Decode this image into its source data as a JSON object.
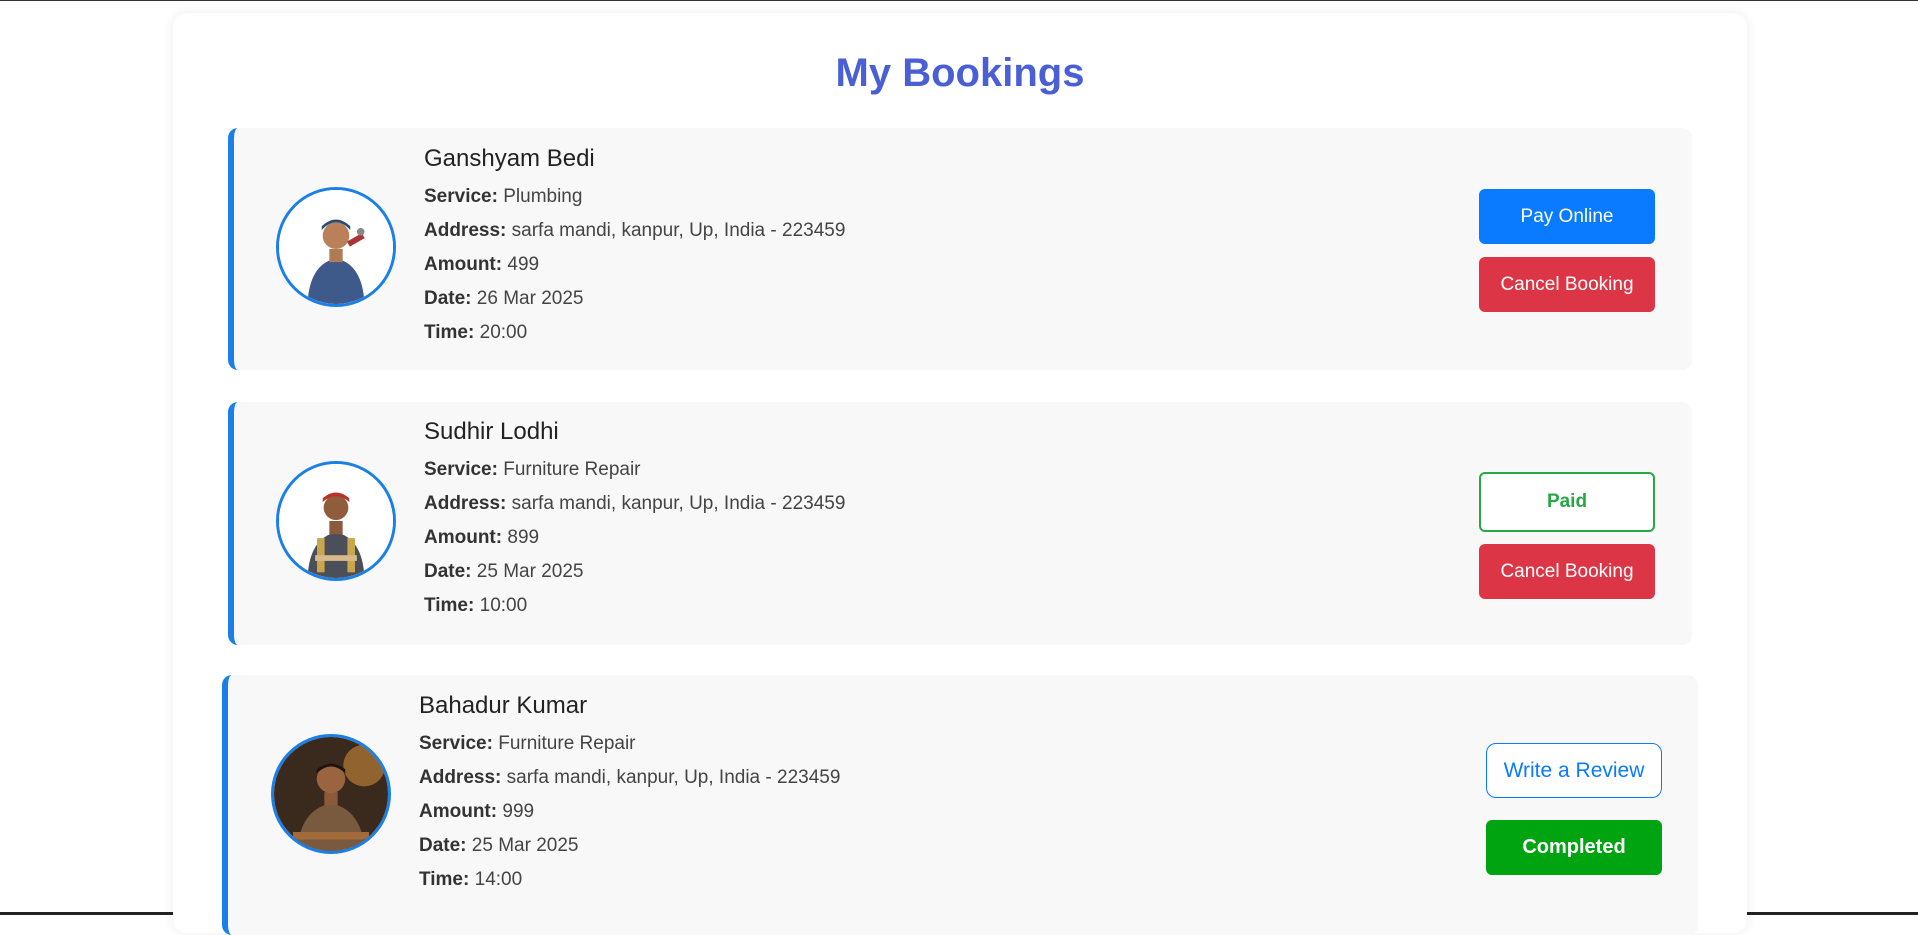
{
  "page": {
    "title": "My Bookings"
  },
  "labels": {
    "service": "Service:",
    "address": "Address:",
    "amount": "Amount:",
    "date": "Date:",
    "time": "Time:"
  },
  "bookings": [
    {
      "name": "Ganshyam Bedi",
      "service": "Plumbing",
      "address": "sarfa mandi, kanpur, Up, India - 223459",
      "amount": "499",
      "date": "26 Mar 2025",
      "time": "20:00",
      "primary_action": "Pay Online",
      "secondary_action": "Cancel Booking"
    },
    {
      "name": "Sudhir Lodhi",
      "service": "Furniture Repair",
      "address": "sarfa mandi, kanpur, Up, India - 223459",
      "amount": "899",
      "date": "25 Mar 2025",
      "time": "10:00",
      "primary_action": "Paid",
      "secondary_action": "Cancel Booking"
    },
    {
      "name": "Bahadur Kumar",
      "service": "Furniture Repair",
      "address": "sarfa mandi, kanpur, Up, India - 223459",
      "amount": "999",
      "date": "25 Mar 2025",
      "time": "14:00",
      "primary_action": "Write a Review",
      "secondary_action": "Completed"
    }
  ],
  "colors": {
    "title": "#4a5fd6",
    "accent": "#1a7fe8",
    "pay": "#0a7bff",
    "cancel": "#dc3545",
    "paid": "#28a745",
    "completed": "#00a310"
  }
}
